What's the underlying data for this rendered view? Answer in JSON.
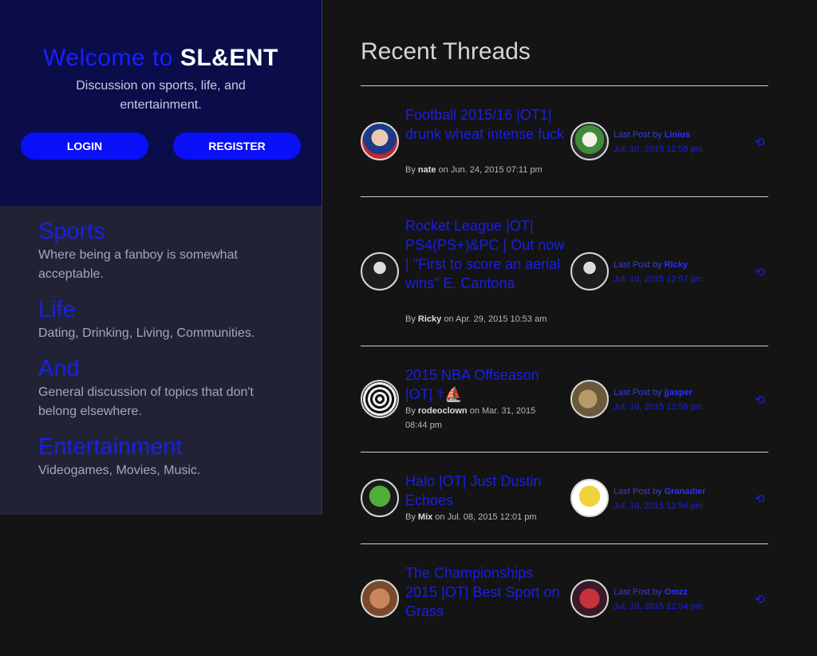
{
  "welcome": {
    "prefix": "Welcome to ",
    "brand": "SL&ENT",
    "tagline": "Discussion on sports, life, and entertainment.",
    "login_label": "LOGIN",
    "register_label": "REGISTER"
  },
  "categories": [
    {
      "name": "Sports",
      "desc": "Where being a fanboy is somewhat acceptable."
    },
    {
      "name": "Life",
      "desc": "Dating, Drinking, Living, Communities."
    },
    {
      "name": "And",
      "desc": "General discussion of topics that don't belong elsewhere."
    },
    {
      "name": "Entertainment",
      "desc": "Videogames, Movies, Music."
    }
  ],
  "recent": {
    "heading": "Recent Threads",
    "by_label": "By ",
    "on_label": " on ",
    "last_post_label": "Last Post by ",
    "threads": [
      {
        "title": "Football 2015/16 |OT1| drunk wheat intense fuck",
        "author": "nate",
        "date": "Jun. 24, 2015 07:11 pm",
        "last_by": "Linius",
        "last_date": "Jul. 10, 2015 12:58 pm"
      },
      {
        "title": "Rocket League |OT| PS4(PS+)&PC | Out now | \"First to score an aerial wins\" E. Cantona",
        "author": "Ricky",
        "date": "Apr. 29, 2015 10:53 am",
        "last_by": "Ricky",
        "last_date": "Jul. 10, 2015 12:57 pm"
      },
      {
        "title": "2015 NBA Offseason |OT| ⚕⛵",
        "author": "rodeoclown",
        "date": "Mar. 31, 2015 08:44 pm",
        "last_by": "jjasper",
        "last_date": "Jul. 10, 2015 12:56 pm"
      },
      {
        "title": "Halo |OT| Just Dustin Echoes",
        "author": "Mix",
        "date": "Jul. 08, 2015 12:01 pm",
        "last_by": "Granadier",
        "last_date": "Jul. 10, 2015 12:54 pm"
      },
      {
        "title": "The Championships 2015 |OT| Best Sport on Grass",
        "author": "",
        "date": "",
        "last_by": "Omzz",
        "last_date": "Jul. 10, 2015 12:54 pm"
      }
    ]
  },
  "icons": {
    "recent": "recent-history-icon"
  },
  "colors": {
    "accent": "#1a1fe8",
    "welcome_bg": "#0a0d4a",
    "categories_bg": "#212334",
    "page_bg": "#141414"
  }
}
